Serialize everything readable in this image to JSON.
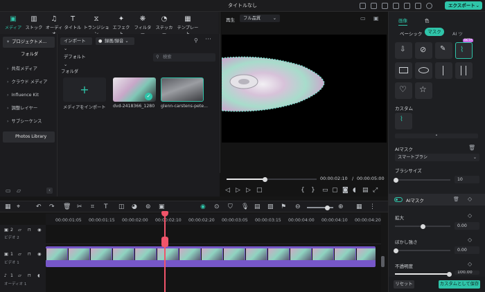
{
  "window": {
    "title": "タイトルなし",
    "export_label": "エクスポート"
  },
  "toolbar": {
    "items": [
      {
        "label": "メディア",
        "icon": "media-icon"
      },
      {
        "label": "ストック",
        "icon": "stock-icon"
      },
      {
        "label": "オーディオ",
        "icon": "audio-icon"
      },
      {
        "label": "タイトル",
        "icon": "title-icon"
      },
      {
        "label": "トランジション",
        "icon": "transition-icon"
      },
      {
        "label": "エフェクト",
        "icon": "effect-icon"
      },
      {
        "label": "フィルター",
        "icon": "filter-icon"
      },
      {
        "label": "ステッカー",
        "icon": "sticker-icon"
      },
      {
        "label": "テンプレート",
        "icon": "template-icon"
      }
    ]
  },
  "sidebar": {
    "items": [
      "プロジェクトメ...",
      "フォルダ",
      "共有メディア",
      "クラウド メディア",
      "Influence Kit",
      "調整レイヤー",
      "サブシーケンス",
      "Photos Library"
    ]
  },
  "media": {
    "import_label": "インポート",
    "record_label": "録画/録音",
    "sort_label": "デフォルト",
    "search_placeholder": "検索",
    "folder_label": "フォルダ",
    "import_tile_label": "メディアをインポート",
    "items": [
      {
        "name": "dvd-2418366_1280"
      },
      {
        "name": "glenn-carstens-pete..."
      }
    ]
  },
  "preview": {
    "tab_label": "再生",
    "quality": "フル品質",
    "time_current": "00:00:02:10",
    "time_separator": "/",
    "time_total": "00:00:05:00",
    "progress": 0.42
  },
  "properties": {
    "tabs": [
      "画像",
      "色"
    ],
    "subtabs": [
      "ベーシック",
      "マスク",
      "AI ツ"
    ],
    "beta_label": "BETA",
    "custom_label": "カスタム",
    "ai_mask_label": "AIマスク",
    "smart_brush": "スマートブラシ",
    "brush_size_label": "ブラシサイズ",
    "brush_size_value": "10",
    "ai_mask_toggle_label": "AIマスク",
    "expand_label": "拡大",
    "expand_value": "0.00",
    "blur_label": "ぼかし強さ",
    "blur_value": "0.00",
    "opacity_label": "不透明度",
    "opacity_value": "100.00",
    "reset_label": "リセット",
    "save_label": "カスタムとして保存"
  },
  "timeline": {
    "ruler": [
      "00:00:01:05",
      "00:00:01:15",
      "00:00:02:00",
      "00:00:02:10",
      "00:00:02:20",
      "00:00:03:05",
      "00:00:03:15",
      "00:00:04:00",
      "00:00:04:10",
      "00:00:04:20"
    ],
    "tracks": [
      {
        "num": "2",
        "name": "ビデオ 2"
      },
      {
        "num": "1",
        "name": "ビデオ 1"
      },
      {
        "num": "1",
        "name": "オーディオ 1"
      }
    ]
  },
  "colors": {
    "accent": "#2fc4a9",
    "playhead": "#f0546a",
    "clip": "#7657c8"
  }
}
